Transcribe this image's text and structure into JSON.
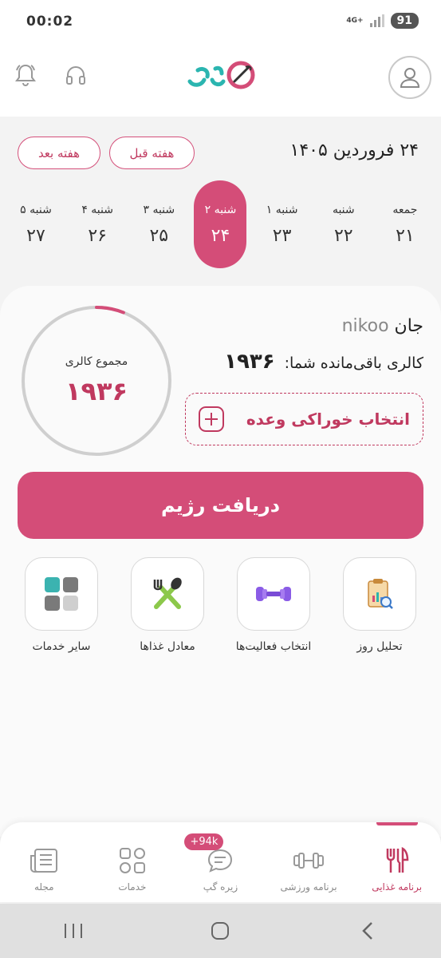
{
  "status_bar": {
    "time": "00:02",
    "network": "4G+",
    "battery": "91"
  },
  "header": {
    "logo_name": "zireh-logo"
  },
  "week": {
    "date_title": "۲۴ فروردین ۱۴۰۵",
    "prev_week_label": "هفته قبل",
    "next_week_label": "هفته بعد",
    "days": [
      {
        "name": "جمعه",
        "num": "۲۱"
      },
      {
        "name": "شنبه",
        "num": "۲۲"
      },
      {
        "name": "۱ شنبه",
        "num": "۲۳"
      },
      {
        "name": "۲ شنبه",
        "num": "۲۴",
        "active": true
      },
      {
        "name": "۳ شنبه",
        "num": "۲۵"
      },
      {
        "name": "۴ شنبه",
        "num": "۲۶"
      },
      {
        "name": "۵ شنبه",
        "num": "۲۷"
      }
    ]
  },
  "summary": {
    "ring_label": "مجموع کالری",
    "ring_value": "۱۹۳۶",
    "ring_progress": 0.06,
    "user_name": "nikoo",
    "greeting_suffix": "جان",
    "remaining_label": "کالری باقی‌مانده شما:",
    "remaining_value": "۱۹۳۶",
    "meal_select_label": "انتخاب خوراکی وعده"
  },
  "cta": {
    "label": "دریافت رژیم"
  },
  "tiles": [
    {
      "label": "تحلیل روز",
      "icon": "clipboard-chart-icon"
    },
    {
      "label": "انتخاب فعالیت‌ها",
      "icon": "dumbbell-icon"
    },
    {
      "label": "معادل غذاها",
      "icon": "fork-spoon-icon"
    },
    {
      "label": "سایر خدمات",
      "icon": "grid-icon"
    }
  ],
  "bottom_nav": {
    "items": [
      {
        "label": "برنامه غذایی",
        "icon": "fork-knife-icon",
        "active": true
      },
      {
        "label": "برنامه ورزشی",
        "icon": "dumbbell-outline-icon"
      },
      {
        "label": "زیره گپ",
        "icon": "chat-icon",
        "badge": "+94k"
      },
      {
        "label": "خدمات",
        "icon": "grid-outline-icon"
      },
      {
        "label": "مجله",
        "icon": "newspaper-icon"
      }
    ]
  },
  "colors": {
    "accent": "#d44d78",
    "accent_dark": "#c0395f",
    "ring_track": "#cfcfcf"
  }
}
